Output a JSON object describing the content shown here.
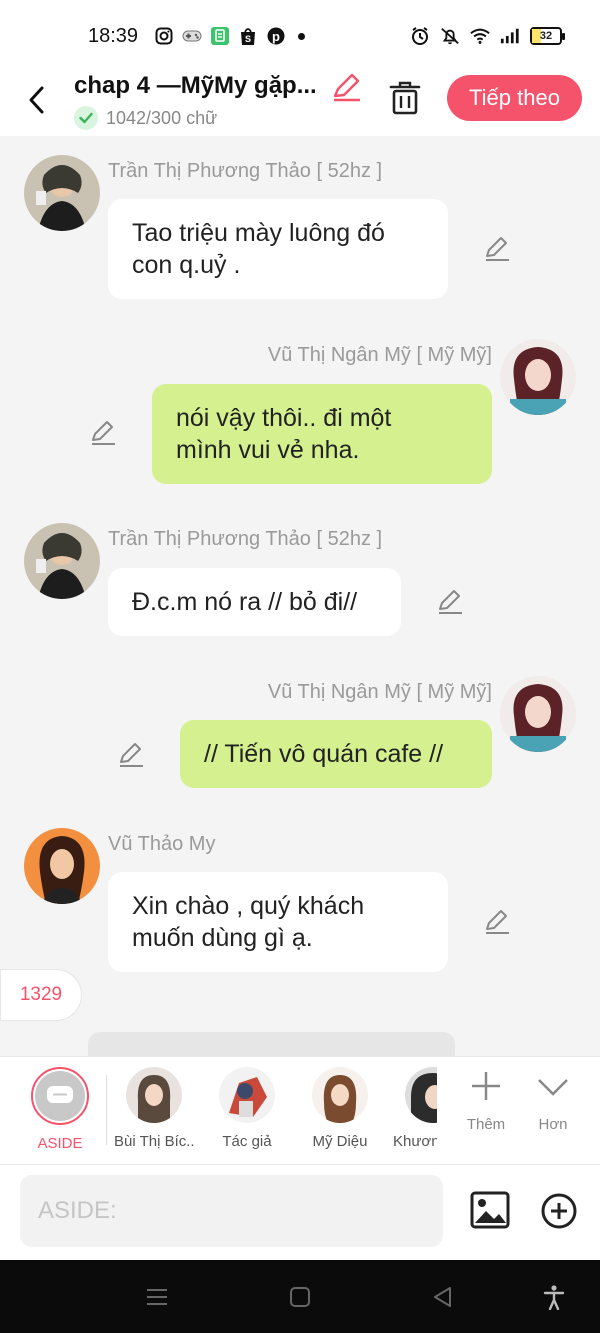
{
  "status_bar": {
    "time": "18:39",
    "battery": "32",
    "battery_fraction": 0.32,
    "icons_left": [
      "instagram-icon",
      "game-icon",
      "app-icon",
      "shopee-icon",
      "pinterest-icon",
      "dot-icon"
    ],
    "icons_right": [
      "alarm-icon",
      "mute-icon",
      "wifi-icon",
      "signal-icon",
      "battery-icon"
    ]
  },
  "header": {
    "title": "chap 4 —MỹMy gặp...",
    "word_count": "1042/300 chữ",
    "next_label": "Tiếp theo"
  },
  "messages": [
    {
      "side": "left",
      "sender": "Trần Thị Phương Thảo [ 52hz ]",
      "text": "Tao triệu mày luông đó con q.uỷ .",
      "line1": "Tao triệu mày luông đó",
      "line2": "con q.uỷ ."
    },
    {
      "side": "right",
      "sender": "Vũ Thị Ngân Mỹ [ Mỹ Mỹ]",
      "line1": "nói vậy thôi.. đi một",
      "line2": "mình vui vẻ nha."
    },
    {
      "side": "left",
      "sender": "Trần Thị Phương Thảo [ 52hz ]",
      "line1": "Đ.c.m nó ra // bỏ đi//"
    },
    {
      "side": "right",
      "sender": "Vũ Thị Ngân Mỹ [ Mỹ Mỹ]",
      "line1": "// Tiến vô quán cafe //"
    },
    {
      "side": "left",
      "sender": "Vũ Thảo My",
      "line1": "Xin chào , quý khách",
      "line2": "muốn dùng gì ạ."
    }
  ],
  "count_badge": "1329",
  "characters": [
    {
      "name": "ASIDE"
    },
    {
      "name": "Bùi Thị Bíc..."
    },
    {
      "name": "Tác giả"
    },
    {
      "name": "Mỹ Diệu"
    },
    {
      "name": "Khươn"
    }
  ],
  "actions": {
    "add_label": "Thêm",
    "more_label": "Hơn"
  },
  "input": {
    "placeholder": "ASIDE:"
  },
  "colors": {
    "accent": "#f5536b",
    "right_bubble": "#d5f08e",
    "left_bubble": "#ffffff",
    "background": "#f4f4f4"
  }
}
